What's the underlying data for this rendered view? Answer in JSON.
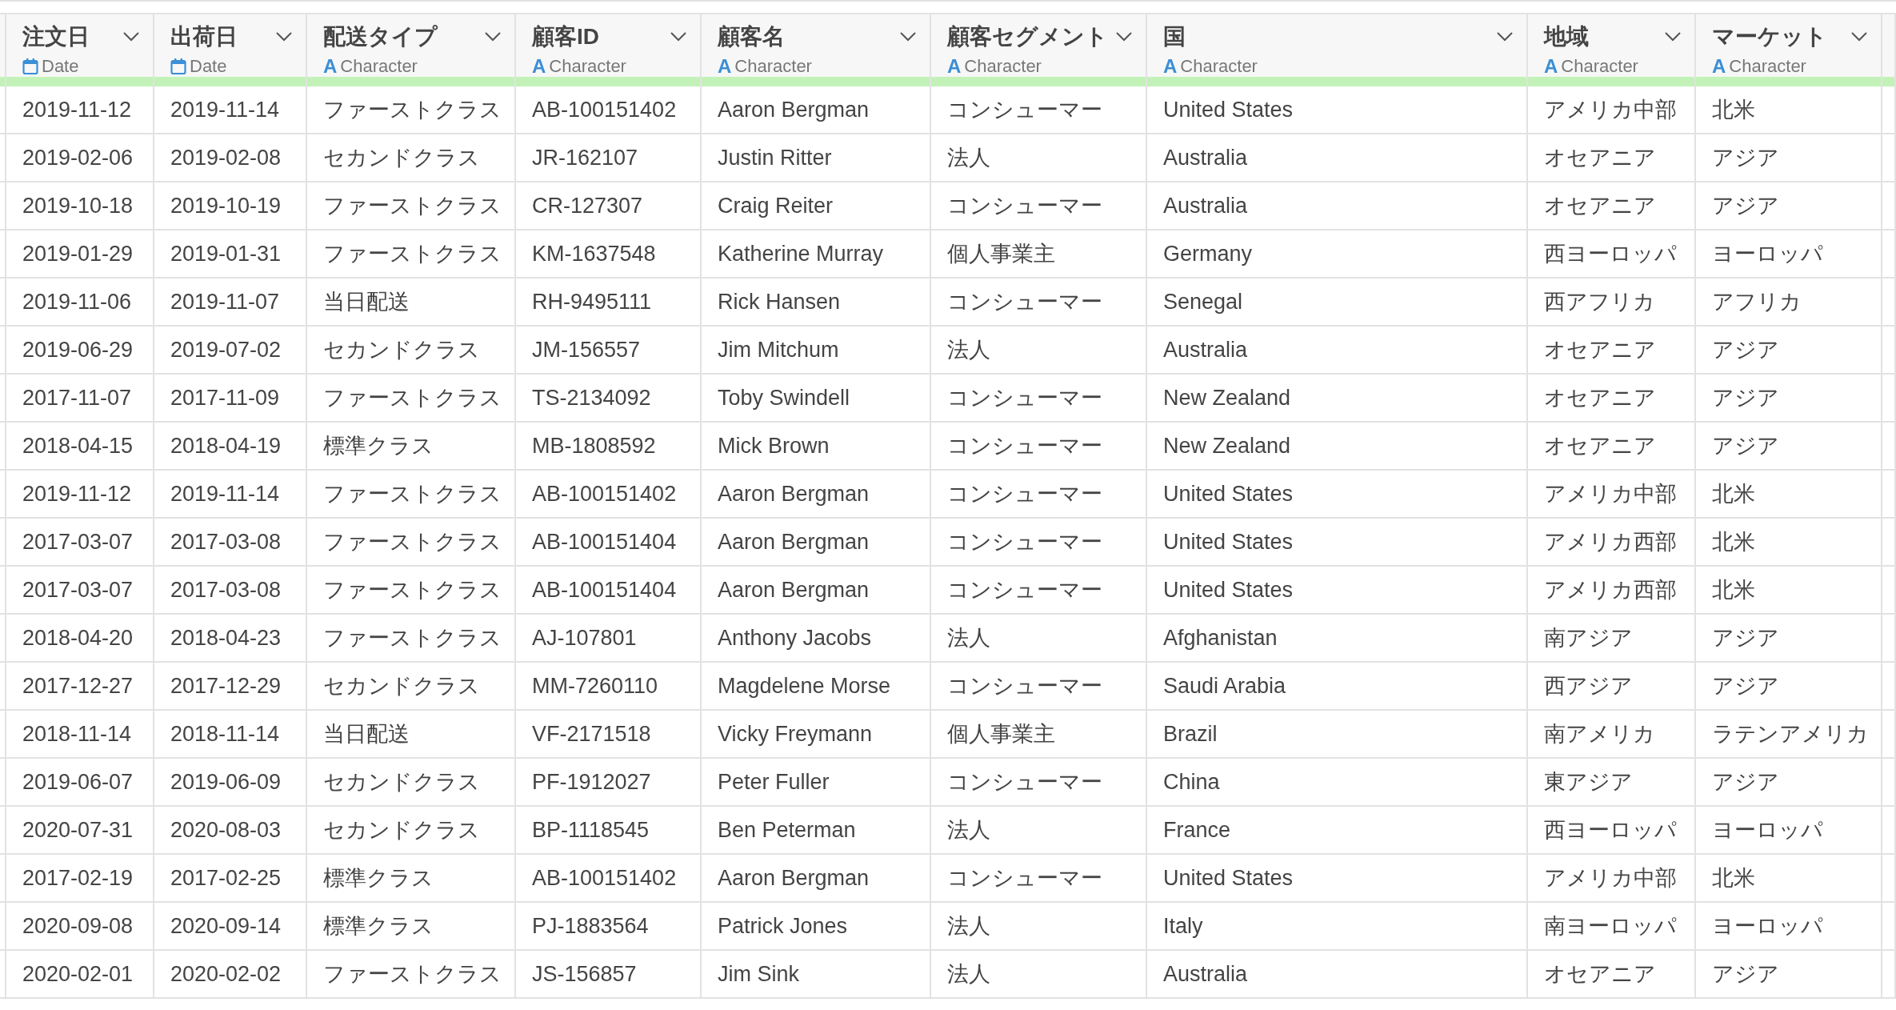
{
  "table": {
    "columns": [
      {
        "label": "注文日",
        "kind": "date",
        "type_label": "Date"
      },
      {
        "label": "出荷日",
        "kind": "date",
        "type_label": "Date"
      },
      {
        "label": "配送タイプ",
        "kind": "character",
        "type_icon": "A",
        "type_label": "Character"
      },
      {
        "label": "顧客ID",
        "kind": "character",
        "type_icon": "A",
        "type_label": "Character"
      },
      {
        "label": "顧客名",
        "kind": "character",
        "type_icon": "A",
        "type_label": "Character"
      },
      {
        "label": "顧客セグメント",
        "kind": "character",
        "type_icon": "A",
        "type_label": "Character"
      },
      {
        "label": "国",
        "kind": "character",
        "type_icon": "A",
        "type_label": "Character"
      },
      {
        "label": "地域",
        "kind": "character",
        "type_icon": "A",
        "type_label": "Character"
      },
      {
        "label": "マーケット",
        "kind": "character",
        "type_icon": "A",
        "type_label": "Character"
      }
    ],
    "rows": [
      [
        "2019-11-12",
        "2019-11-14",
        "ファーストクラス",
        "AB-100151402",
        "Aaron Bergman",
        "コンシューマー",
        "United States",
        "アメリカ中部",
        "北米"
      ],
      [
        "2019-02-06",
        "2019-02-08",
        "セカンドクラス",
        "JR-162107",
        "Justin Ritter",
        "法人",
        "Australia",
        "オセアニア",
        "アジア"
      ],
      [
        "2019-10-18",
        "2019-10-19",
        "ファーストクラス",
        "CR-127307",
        "Craig Reiter",
        "コンシューマー",
        "Australia",
        "オセアニア",
        "アジア"
      ],
      [
        "2019-01-29",
        "2019-01-31",
        "ファーストクラス",
        "KM-1637548",
        "Katherine Murray",
        "個人事業主",
        "Germany",
        "西ヨーロッパ",
        "ヨーロッパ"
      ],
      [
        "2019-11-06",
        "2019-11-07",
        "当日配送",
        "RH-9495111",
        "Rick Hansen",
        "コンシューマー",
        "Senegal",
        "西アフリカ",
        "アフリカ"
      ],
      [
        "2019-06-29",
        "2019-07-02",
        "セカンドクラス",
        "JM-156557",
        "Jim Mitchum",
        "法人",
        "Australia",
        "オセアニア",
        "アジア"
      ],
      [
        "2017-11-07",
        "2017-11-09",
        "ファーストクラス",
        "TS-2134092",
        "Toby Swindell",
        "コンシューマー",
        "New Zealand",
        "オセアニア",
        "アジア"
      ],
      [
        "2018-04-15",
        "2018-04-19",
        "標準クラス",
        "MB-1808592",
        "Mick Brown",
        "コンシューマー",
        "New Zealand",
        "オセアニア",
        "アジア"
      ],
      [
        "2019-11-12",
        "2019-11-14",
        "ファーストクラス",
        "AB-100151402",
        "Aaron Bergman",
        "コンシューマー",
        "United States",
        "アメリカ中部",
        "北米"
      ],
      [
        "2017-03-07",
        "2017-03-08",
        "ファーストクラス",
        "AB-100151404",
        "Aaron Bergman",
        "コンシューマー",
        "United States",
        "アメリカ西部",
        "北米"
      ],
      [
        "2017-03-07",
        "2017-03-08",
        "ファーストクラス",
        "AB-100151404",
        "Aaron Bergman",
        "コンシューマー",
        "United States",
        "アメリカ西部",
        "北米"
      ],
      [
        "2018-04-20",
        "2018-04-23",
        "ファーストクラス",
        "AJ-107801",
        "Anthony Jacobs",
        "法人",
        "Afghanistan",
        "南アジア",
        "アジア"
      ],
      [
        "2017-12-27",
        "2017-12-29",
        "セカンドクラス",
        "MM-7260110",
        "Magdelene Morse",
        "コンシューマー",
        "Saudi Arabia",
        "西アジア",
        "アジア"
      ],
      [
        "2018-11-14",
        "2018-11-14",
        "当日配送",
        "VF-2171518",
        "Vicky Freymann",
        "個人事業主",
        "Brazil",
        "南アメリカ",
        "ラテンアメリカ"
      ],
      [
        "2019-06-07",
        "2019-06-09",
        "セカンドクラス",
        "PF-1912027",
        "Peter Fuller",
        "コンシューマー",
        "China",
        "東アジア",
        "アジア"
      ],
      [
        "2020-07-31",
        "2020-08-03",
        "セカンドクラス",
        "BP-1118545",
        "Ben Peterman",
        "法人",
        "France",
        "西ヨーロッパ",
        "ヨーロッパ"
      ],
      [
        "2017-02-19",
        "2017-02-25",
        "標準クラス",
        "AB-100151402",
        "Aaron Bergman",
        "コンシューマー",
        "United States",
        "アメリカ中部",
        "北米"
      ],
      [
        "2020-09-08",
        "2020-09-14",
        "標準クラス",
        "PJ-1883564",
        "Patrick Jones",
        "法人",
        "Italy",
        "南ヨーロッパ",
        "ヨーロッパ"
      ],
      [
        "2020-02-01",
        "2020-02-02",
        "ファーストクラス",
        "JS-156857",
        "Jim Sink",
        "法人",
        "Australia",
        "オセアニア",
        "アジア"
      ]
    ]
  }
}
